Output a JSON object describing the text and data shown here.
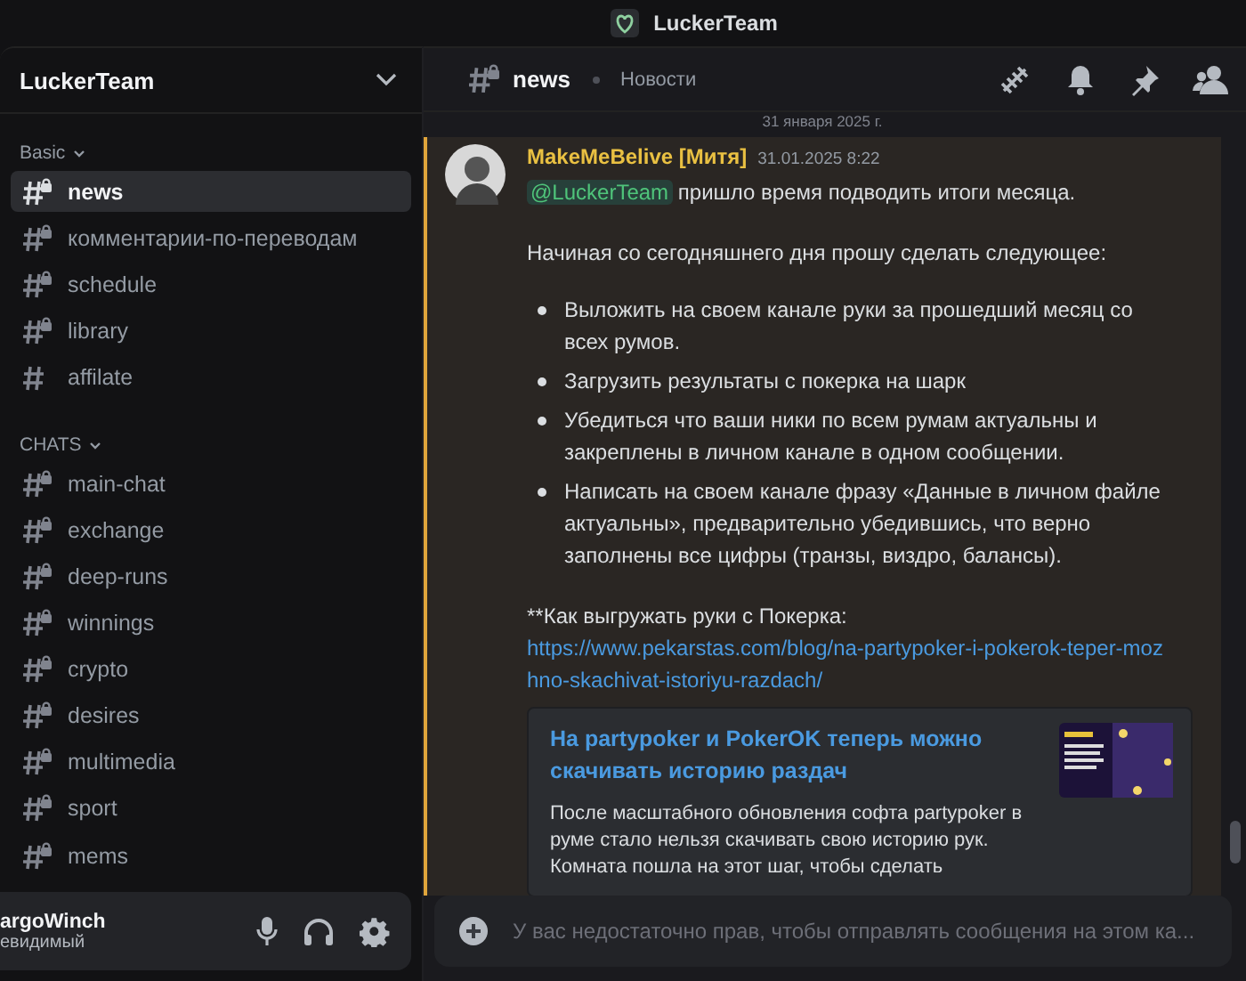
{
  "window": {
    "title": "LuckerTeam"
  },
  "server": {
    "name": "LuckerTeam"
  },
  "categories": [
    {
      "name": "Basic",
      "channels": [
        {
          "name": "news",
          "locked": true,
          "selected": true
        },
        {
          "name": "комментарии-по-переводам",
          "locked": true,
          "selected": false
        },
        {
          "name": "schedule",
          "locked": true,
          "selected": false
        },
        {
          "name": "library",
          "locked": true,
          "selected": false
        },
        {
          "name": "affilate",
          "locked": false,
          "selected": false
        }
      ]
    },
    {
      "name": "CHATS",
      "channels": [
        {
          "name": "main-chat",
          "locked": true,
          "selected": false
        },
        {
          "name": "exchange",
          "locked": true,
          "selected": false
        },
        {
          "name": "deep-runs",
          "locked": true,
          "selected": false
        },
        {
          "name": "winnings",
          "locked": true,
          "selected": false
        },
        {
          "name": "crypto",
          "locked": true,
          "selected": false
        },
        {
          "name": "desires",
          "locked": true,
          "selected": false
        },
        {
          "name": "multimedia",
          "locked": true,
          "selected": false
        },
        {
          "name": "sport",
          "locked": true,
          "selected": false
        },
        {
          "name": "mems",
          "locked": true,
          "selected": false
        }
      ]
    }
  ],
  "user": {
    "name": "argoWinch",
    "status": "евидимый"
  },
  "header": {
    "channel": "news",
    "topic": "Новости"
  },
  "date_divider": "31 января 2025 г.",
  "message": {
    "author": "MakeMeBelive [Митя]",
    "time": "31.01.2025 8:22",
    "mention": "@LuckerTeam",
    "first_line": "пришло время подводить итоги месяца.",
    "intro": "Начиная со сегодняшнего дня прошу сделать следующее:",
    "bullets": [
      "Выложить на своем канале руки за прошедший месяц со всех румов.",
      "Загрузить результаты с покерка на шарк",
      "Убедиться что ваши ники по всем румам актуальны и закреплены в личном канале в одном сообщении.",
      "Написать на своем канале фразу «Данные в личном файле актуальны», предварительно убедившись, что верно заполнены все цифры (транзы, виздро, балансы)."
    ],
    "howto": "**Как выгружать руки с Покерка:",
    "link": "https://www.pekarstas.com/blog/na-partypoker-i-pokerok-teper-mozhno-skachivat-istoriyu-razdach/",
    "embed": {
      "title": "На partypoker и PokerOK теперь можно скачивать историю раздач",
      "description": "После масштабного обновления софта partypoker в руме стало нельзя скачивать свою историю рук. Комната пошла на этот шаг, чтобы сделать"
    }
  },
  "composer": {
    "placeholder": "У вас недостаточно прав, чтобы отправлять сообщения на этом ка..."
  }
}
